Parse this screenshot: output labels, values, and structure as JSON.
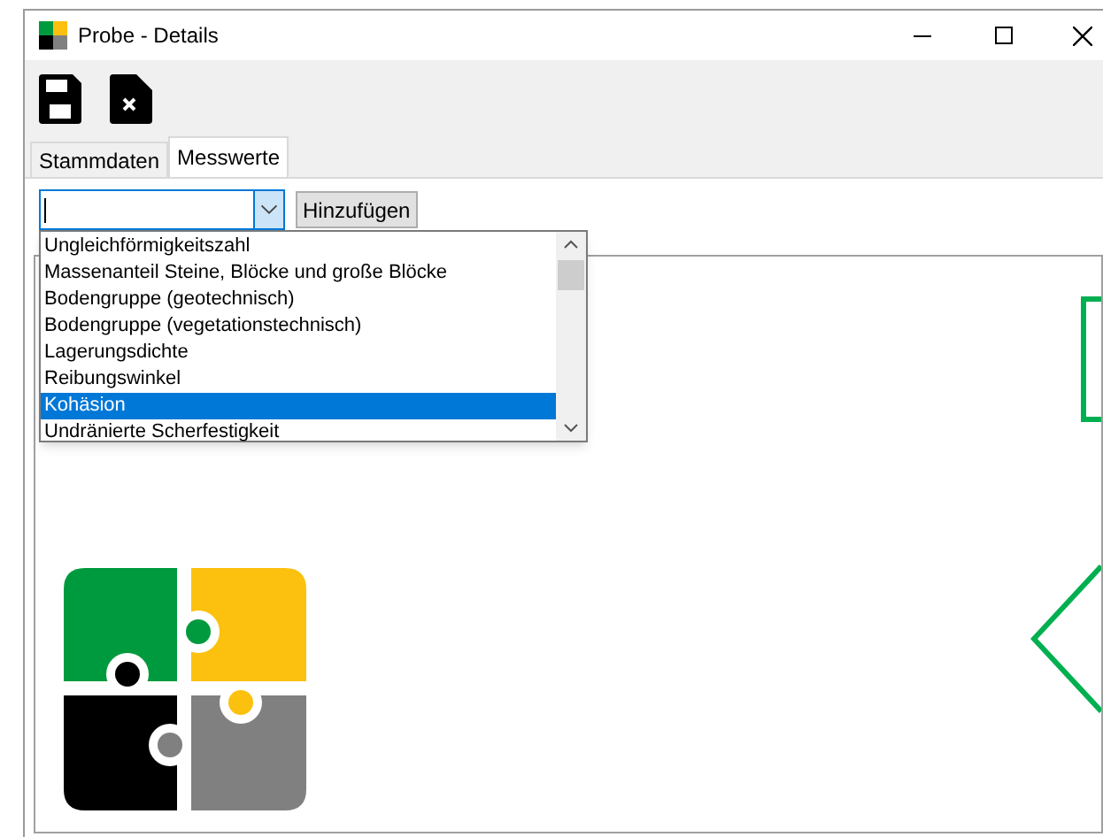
{
  "window": {
    "title": "Probe - Details"
  },
  "tabs": [
    {
      "label": "Stammdaten",
      "selected": false
    },
    {
      "label": "Messwerte",
      "selected": true
    }
  ],
  "add_button": "Hinzufügen",
  "dropdown": [
    {
      "label": "Ungleichförmigkeitszahl",
      "selected": false
    },
    {
      "label": "Massenanteil Steine, Blöcke und große Blöcke",
      "selected": false
    },
    {
      "label": "Bodengruppe (geotechnisch)",
      "selected": false
    },
    {
      "label": "Bodengruppe (vegetationstechnisch)",
      "selected": false
    },
    {
      "label": "Lagerungsdichte",
      "selected": false
    },
    {
      "label": "Reibungswinkel",
      "selected": false
    },
    {
      "label": "Kohäsion",
      "selected": true
    },
    {
      "label": "Undränierte Scherfestigkeit",
      "selected": false
    }
  ]
}
